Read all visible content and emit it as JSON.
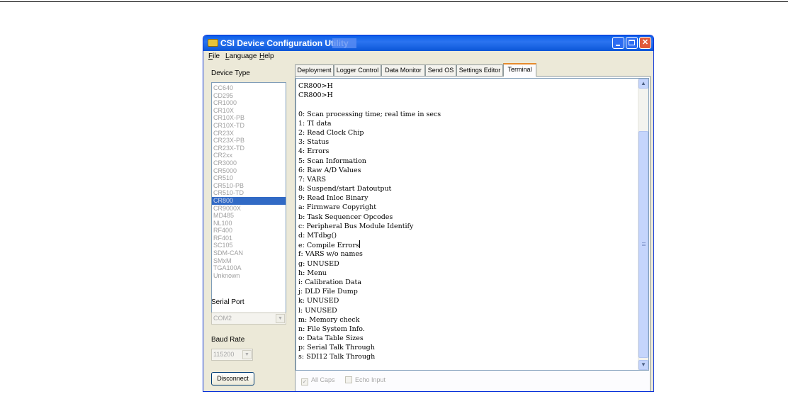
{
  "window": {
    "title": "CSI Device Configuration Utility",
    "minimize": "minimize",
    "maximize": "maximize",
    "close": "close"
  },
  "menu": {
    "file_mnemonic": "F",
    "file_rest": "ile",
    "lang_mnemonic": "L",
    "lang_rest": "anguage",
    "help_mnemonic": "H",
    "help_rest": "elp"
  },
  "left": {
    "device_type_label": "Device Type",
    "devices": [
      "CC640",
      "CD295",
      "CR1000",
      "CR10X",
      "CR10X-PB",
      "CR10X-TD",
      "CR23X",
      "CR23X-PB",
      "CR23X-TD",
      "CR2xx",
      "CR3000",
      "CR5000",
      "CR510",
      "CR510-PB",
      "CR510-TD",
      "CR800",
      "CR9000X",
      "MD485",
      "NL100",
      "RF400",
      "RF401",
      "SC105",
      "SDM-CAN",
      "SMxM",
      "TGA100A",
      "Unknown"
    ],
    "selected_device": "CR800",
    "serial_port_label": "Serial Port",
    "serial_port_value": "COM2",
    "baud_rate_label": "Baud Rate",
    "baud_rate_value": "115200",
    "disconnect_button": "Disconnect"
  },
  "tabs": [
    {
      "label": "Deployment",
      "active": false
    },
    {
      "label": "Logger Control",
      "active": false
    },
    {
      "label": "Data Monitor",
      "active": false
    },
    {
      "label": "Send OS",
      "active": false
    },
    {
      "label": "Settings Editor",
      "active": false
    },
    {
      "label": "Terminal",
      "active": true
    }
  ],
  "terminal": {
    "lines": [
      "CR800>H",
      "CR800>H",
      "",
      "0: Scan processing time; real time in secs",
      "1: TI data",
      "2: Read Clock Chip",
      "3: Status",
      "4: Errors",
      "5: Scan Information",
      "6: Raw A/D Values",
      "7: VARS",
      "8: Suspend/start Datoutput",
      "9: Read Inloc Binary",
      "a: Firmware Copyright",
      "b: Task Sequencer Opcodes",
      "c: Peripheral Bus Module Identify",
      "d: MTdbg()",
      "e: Compile Errors",
      "f: VARS w/o names",
      "g: UNUSED",
      "h: Menu",
      "i: Calibration Data",
      "j: DLD File Dump",
      "k: UNUSED",
      "l: UNUSED",
      "m: Memory check",
      "n: File System Info.",
      "o: Data Table Sizes",
      "p: Serial Talk Through",
      "s: SDI12 Talk Through"
    ],
    "all_caps_label": "All Caps",
    "all_caps_checked": true,
    "echo_input_label": "Echo Input",
    "echo_input_checked": false
  }
}
